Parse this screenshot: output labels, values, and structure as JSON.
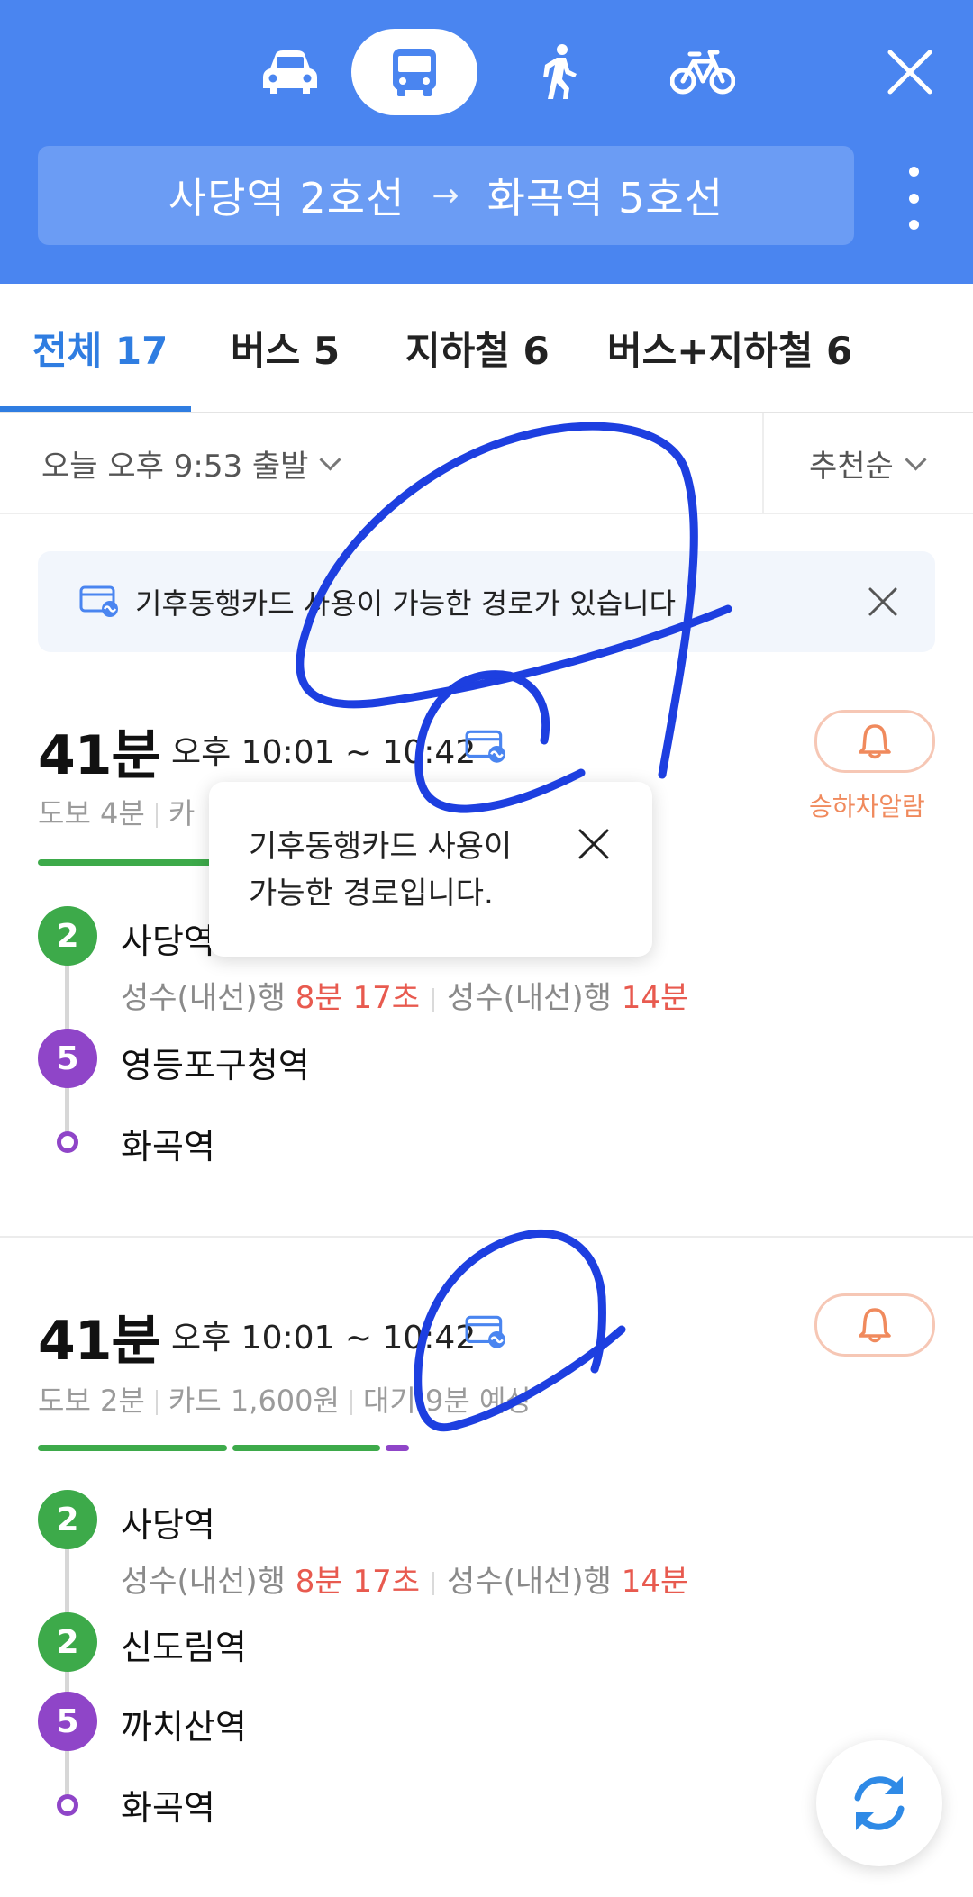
{
  "header": {
    "modes": [
      "car-icon",
      "bus-icon",
      "walk-icon",
      "bike-icon"
    ],
    "active_mode": "bus",
    "route_from": "사당역 2호선",
    "route_arrow": "→",
    "route_to": "화곡역 5호선"
  },
  "tabs": [
    {
      "label": "전체 17",
      "active": true
    },
    {
      "label": "버스 5",
      "active": false
    },
    {
      "label": "지하철 6",
      "active": false
    },
    {
      "label": "버스+지하철 6",
      "active": false
    }
  ],
  "filter": {
    "departure": "오늘 오후 9:53 출발",
    "sort": "추천순"
  },
  "notice": {
    "text": "기후동행카드 사용이 가능한 경로가 있습니다"
  },
  "tooltip": {
    "text_line1": "기후동행카드 사용이",
    "text_line2": "가능한 경로입니다."
  },
  "routes": [
    {
      "duration": "41분",
      "time_range": "오후 10:01 ~ 10:42",
      "meta": [
        "도보 4분",
        "카"
      ],
      "alarm_label": "승하차알람",
      "progress": [
        0.39
      ],
      "stops": [
        {
          "badge": "2",
          "name": "사당역",
          "arrivals": [
            {
              "dest": "성수(내선)행",
              "time": "8분 17초"
            },
            {
              "dest": "성수(내선)행",
              "time": "14분"
            }
          ]
        },
        {
          "badge": "5",
          "name": "영등포구청역"
        },
        {
          "badge": "",
          "name": "화곡역"
        }
      ]
    },
    {
      "duration": "41분",
      "time_range": "오후 10:01 ~ 10:42",
      "meta": [
        "도보 2분",
        "카드 1,600원",
        "대기 9분 예상"
      ],
      "progress": [
        0.28,
        0.21,
        0.03
      ],
      "stops": [
        {
          "badge": "2",
          "name": "사당역",
          "arrivals": [
            {
              "dest": "성수(내선)행",
              "time": "8분 17초"
            },
            {
              "dest": "성수(내선)행",
              "time": "14분"
            }
          ]
        },
        {
          "badge": "2",
          "name": "신도림역"
        },
        {
          "badge": "5",
          "name": "까치산역"
        },
        {
          "badge": "",
          "name": "화곡역"
        }
      ]
    }
  ],
  "colors": {
    "header_blue": "#4a85f0",
    "active_tab": "#2f7de1",
    "line2_green": "#3daa4a",
    "line5_purple": "#8f45c8",
    "arrival_red": "#e85a4f",
    "alarm_orange": "#f08a5d",
    "scribble_blue": "#1d3fe0"
  }
}
